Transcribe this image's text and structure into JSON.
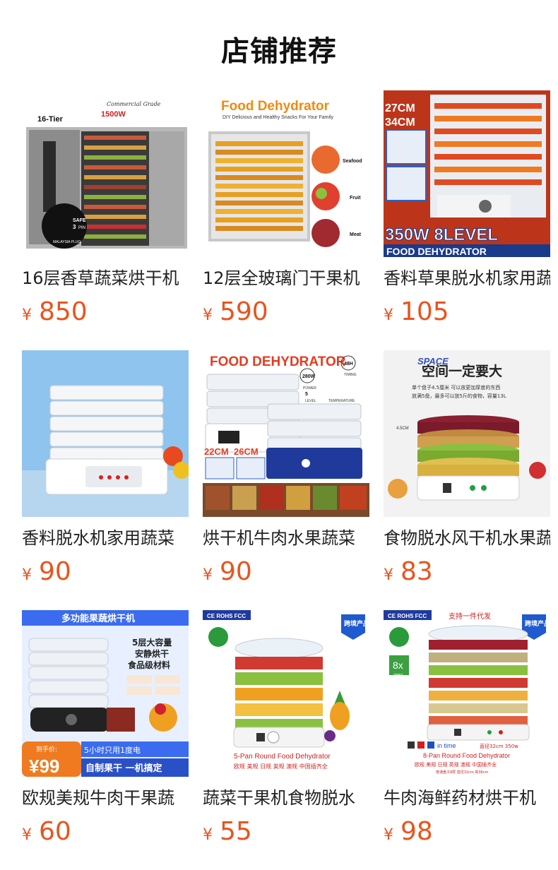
{
  "page": {
    "title": "店铺推荐"
  },
  "currency_symbol": "¥",
  "colors": {
    "price": "#e8541e",
    "title": "#111111"
  },
  "products": [
    {
      "name": "16层香草蔬菜烘干机",
      "price": "850",
      "image_text": [
        "Commercial Grade",
        "1500W",
        "16-Tier",
        "SAFE",
        "3",
        "PIN",
        "MALAYSIA PLUG"
      ]
    },
    {
      "name": "12层全玻璃门干果机",
      "price": "590",
      "image_text": [
        "Food Dehydrator",
        "DIY Delicious and Healthy Snacks For Your Family",
        "Seafood",
        "Fruit",
        "Meat"
      ]
    },
    {
      "name": "香料草果脱水机家用蔬",
      "price": "105",
      "image_text": [
        "27CM",
        "34CM",
        "350W 8LEVEL",
        "FOOD DEHYDRATOR"
      ]
    },
    {
      "name": "香料脱水机家用蔬菜",
      "price": "90",
      "image_text": []
    },
    {
      "name": "烘干机牛肉水果蔬菜",
      "price": "90",
      "image_text": [
        "FOOD DEHYDRATOR",
        "280W",
        "POWER",
        "48H",
        "TIMING",
        "5",
        "LEVEL",
        "TEMPERATURE",
        "22CM",
        "26CM"
      ]
    },
    {
      "name": "食物脱水风干机水果蔬",
      "price": "83",
      "image_text": [
        "SPACE",
        "空间一定要大",
        "单个盘子4.5厘米   可以放更加厚度的东西",
        "放满5盘，最多可以放5斤的食物，容量13L",
        "4.5CM"
      ]
    },
    {
      "name": "欧规美规牛肉干果蔬",
      "price": "60",
      "image_text": [
        "多功能果蔬烘干机",
        "5层大容量",
        "安静烘干",
        "食品级材料",
        "到手价:",
        "¥99",
        "5小时只用1度电",
        "自制果干 一机搞定"
      ]
    },
    {
      "name": "蔬菜干果机食物脱水",
      "price": "55",
      "image_text": [
        "CE ROHS FCC",
        "跨境产品",
        "5-Pan Round Food Dehydrator",
        "欧规 美规 日规 英规 澳规 中国插齐全"
      ]
    },
    {
      "name": "牛肉海鲜药材烘干机",
      "price": "98",
      "image_text": [
        "CE ROHS FCC",
        "支持一件代发",
        "跨境产品",
        "8x",
        "plates",
        "in time",
        "直径32cm 350w",
        "8-Pan Round Food Dehydrator",
        "欧规 美规 日规 英规 澳规 中国插齐全",
        "普通盘子8层 直径32cm 高36cm"
      ]
    }
  ]
}
